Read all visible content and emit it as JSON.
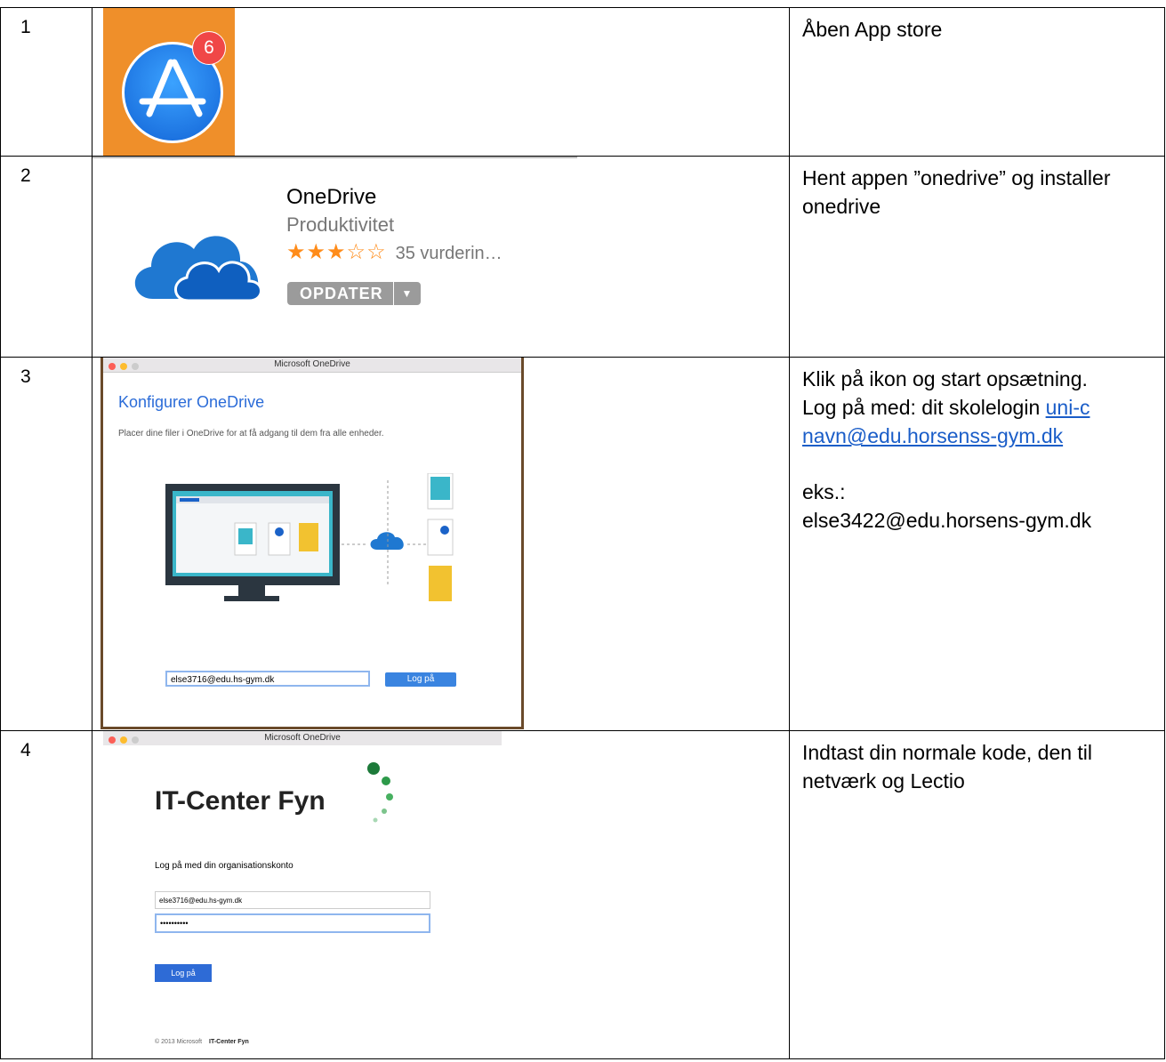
{
  "steps": [
    {
      "num": "1",
      "text": "Åben App store",
      "icon": "app-store-icon",
      "badge": "6"
    },
    {
      "num": "2",
      "text": "Hent appen ”onedrive” og installer onedrive",
      "app": {
        "name": "OneDrive",
        "category": "Produktivitet",
        "stars": "★★★☆☆",
        "rating_count": "35 vurderin…",
        "button": "OPDATER"
      },
      "rating": 3
    },
    {
      "num": "3",
      "text_line1": "Klik på ikon og start opsætning.",
      "text_line2": "Log på med: dit skolelogin ",
      "link": "uni-c navn@edu.horsenss-gym.dk",
      "example_label": "eks.:",
      "example_value": "else3422@edu.horsens-gym.dk",
      "window": {
        "title": "Microsoft OneDrive",
        "heading": "Konfigurer OneDrive",
        "description": "Placer dine filer i OneDrive for at få adgang til dem fra alle enheder.",
        "email": "else3716@edu.hs-gym.dk",
        "button": "Log på"
      }
    },
    {
      "num": "4",
      "text": "Indtast din normale kode, den til netværk og Lectio",
      "window": {
        "title": "Microsoft OneDrive",
        "logo": "IT-Center Fyn",
        "prompt": "Log på med din organisationskonto",
        "username": "else3716@edu.hs-gym.dk",
        "password": "••••••••••",
        "button": "Log på",
        "footer_copyright": "© 2013 Microsoft",
        "footer_brand": "IT-Center Fyn"
      }
    }
  ],
  "colors": {
    "appstore_bg": "#ef8f2a",
    "onedrive_blue": "#1f78d1",
    "link": "#1a5dc8",
    "star": "#ff8c1a"
  }
}
